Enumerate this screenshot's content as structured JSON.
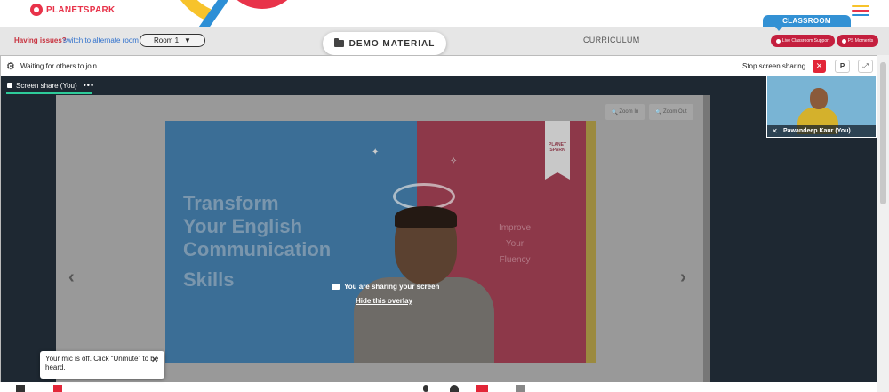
{
  "header": {
    "brand": "PLANETSPARK",
    "accent_colors": [
      "#f7c32b",
      "#e8334a",
      "#2d8fd6"
    ]
  },
  "navbar": {
    "issue_text": "Having issues?",
    "issue_link": "switch to alternate room",
    "room_value": "Room 1",
    "demo_label": "DEMO MATERIAL",
    "curriculum_label": "CURRICULUM",
    "classroom_label": "CLASSROOM",
    "support_label": "Live Classroom Support",
    "moments_label": "PS Moments"
  },
  "meeting": {
    "waiting_text": "Waiting for others to join",
    "stop_share_label": "Stop screen sharing",
    "p_label": "P",
    "share_tab_label": "Screen share (You)",
    "zoom_in_label": "Zoom In",
    "zoom_out_label": "Zoom Out",
    "overlay_text": "You are sharing your screen",
    "overlay_link": "Hide this overlay",
    "participant_name": "Pawandeep Kaur (You)"
  },
  "slide": {
    "title_lines": [
      "Transform",
      "Your English",
      "Communication"
    ],
    "skills_line": "Skills",
    "side_text": [
      "Improve",
      "Your",
      "Fluency"
    ],
    "ribbon_text": "PLANET SPARK"
  },
  "toast": {
    "message": "Your mic is off. Click “Unmute” to be heard."
  },
  "icons": {
    "settings": "gear-icon",
    "close": "close-icon",
    "expand": "expand-icon",
    "folder": "folder-icon",
    "mic_off": "mic-off-icon"
  }
}
